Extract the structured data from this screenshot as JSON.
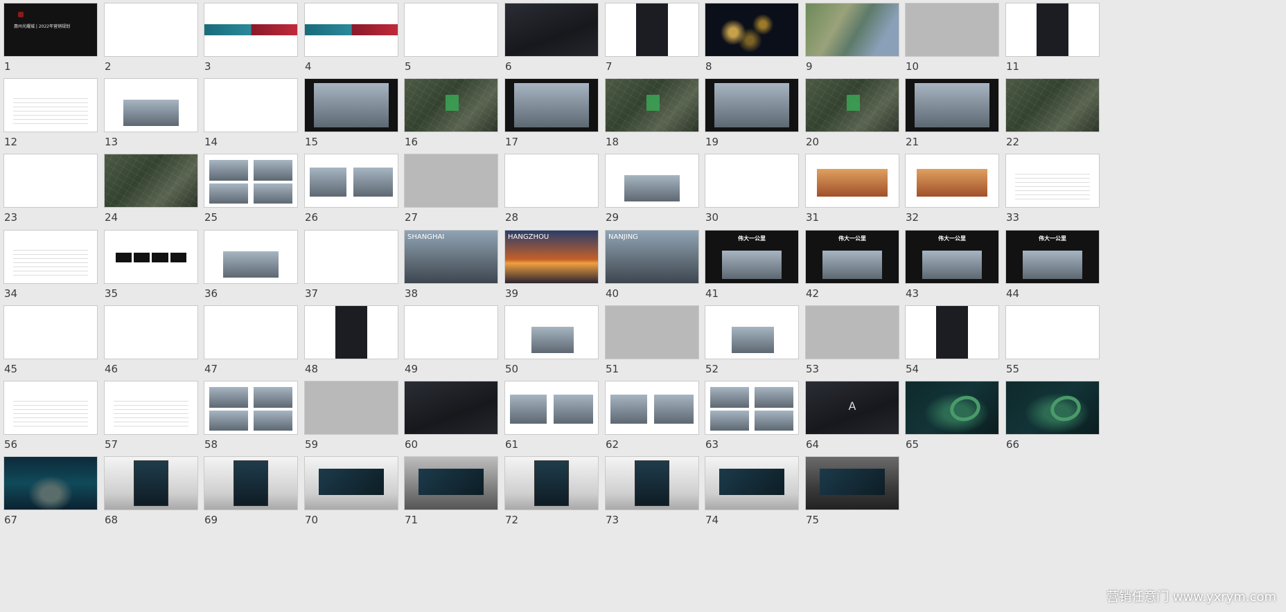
{
  "cover_title": "惠州光耀城 | 2022年营销规划",
  "slides": [
    {
      "n": "1",
      "style": "black",
      "kind": "cover"
    },
    {
      "n": "2",
      "style": "white"
    },
    {
      "n": "3",
      "style": "white",
      "kind": "banner"
    },
    {
      "n": "4",
      "style": "white",
      "kind": "banner"
    },
    {
      "n": "5",
      "style": "white"
    },
    {
      "n": "6",
      "style": "dark"
    },
    {
      "n": "7",
      "style": "white",
      "kind": "panel"
    },
    {
      "n": "8",
      "style": "night"
    },
    {
      "n": "9",
      "style": "sat"
    },
    {
      "n": "10",
      "style": "gray"
    },
    {
      "n": "11",
      "style": "white",
      "kind": "panel"
    },
    {
      "n": "12",
      "style": "white",
      "kind": "doc"
    },
    {
      "n": "13",
      "style": "white",
      "kind": "mapinset"
    },
    {
      "n": "14",
      "style": "white"
    },
    {
      "n": "15",
      "style": "black",
      "kind": "photo"
    },
    {
      "n": "16",
      "style": "map",
      "kind": "plot"
    },
    {
      "n": "17",
      "style": "black",
      "kind": "photo"
    },
    {
      "n": "18",
      "style": "map",
      "kind": "plot"
    },
    {
      "n": "19",
      "style": "black",
      "kind": "photo"
    },
    {
      "n": "20",
      "style": "map",
      "kind": "plot"
    },
    {
      "n": "21",
      "style": "black",
      "kind": "photo"
    },
    {
      "n": "22",
      "style": "map"
    },
    {
      "n": "23",
      "style": "white"
    },
    {
      "n": "24",
      "style": "map"
    },
    {
      "n": "25",
      "style": "white",
      "kind": "collage"
    },
    {
      "n": "26",
      "style": "white",
      "kind": "collage2"
    },
    {
      "n": "27",
      "style": "gray"
    },
    {
      "n": "28",
      "style": "white"
    },
    {
      "n": "29",
      "style": "white",
      "kind": "mapinset"
    },
    {
      "n": "30",
      "style": "white"
    },
    {
      "n": "31",
      "style": "white",
      "kind": "warm"
    },
    {
      "n": "32",
      "style": "white",
      "kind": "warm"
    },
    {
      "n": "33",
      "style": "white",
      "kind": "doc"
    },
    {
      "n": "34",
      "style": "white",
      "kind": "doc"
    },
    {
      "n": "35",
      "style": "white",
      "kind": "boxes"
    },
    {
      "n": "36",
      "style": "white",
      "kind": "mapinset"
    },
    {
      "n": "37",
      "style": "white"
    },
    {
      "n": "38",
      "style": "photo",
      "kind": "city",
      "city": "SHANGHAI"
    },
    {
      "n": "39",
      "style": "sunset",
      "kind": "city",
      "city": "HANGZHOU"
    },
    {
      "n": "40",
      "style": "photo",
      "kind": "city",
      "city": "NANJING"
    },
    {
      "n": "41",
      "style": "black",
      "kind": "headline",
      "headline": "伟大一公里"
    },
    {
      "n": "42",
      "style": "black",
      "kind": "headline",
      "headline": "伟大一公里"
    },
    {
      "n": "43",
      "style": "black",
      "kind": "headline",
      "headline": "伟大一公里"
    },
    {
      "n": "44",
      "style": "black",
      "kind": "headline",
      "headline": "伟大一公里"
    },
    {
      "n": "45",
      "style": "white"
    },
    {
      "n": "46",
      "style": "white"
    },
    {
      "n": "47",
      "style": "white"
    },
    {
      "n": "48",
      "style": "white",
      "kind": "panel"
    },
    {
      "n": "49",
      "style": "white"
    },
    {
      "n": "50",
      "style": "white",
      "kind": "photo-small"
    },
    {
      "n": "51",
      "style": "gray"
    },
    {
      "n": "52",
      "style": "white",
      "kind": "photo-small"
    },
    {
      "n": "53",
      "style": "gray"
    },
    {
      "n": "54",
      "style": "white",
      "kind": "panel"
    },
    {
      "n": "55",
      "style": "white"
    },
    {
      "n": "56",
      "style": "white",
      "kind": "doc"
    },
    {
      "n": "57",
      "style": "white",
      "kind": "doc"
    },
    {
      "n": "58",
      "style": "white",
      "kind": "collage"
    },
    {
      "n": "59",
      "style": "gray"
    },
    {
      "n": "60",
      "style": "dark"
    },
    {
      "n": "61",
      "style": "white",
      "kind": "collage2"
    },
    {
      "n": "62",
      "style": "white",
      "kind": "collage2"
    },
    {
      "n": "63",
      "style": "white",
      "kind": "collage"
    },
    {
      "n": "64",
      "style": "dark",
      "kind": "letter",
      "letter": "A"
    },
    {
      "n": "65",
      "style": "teal",
      "kind": "ring"
    },
    {
      "n": "66",
      "style": "teal",
      "kind": "ring"
    },
    {
      "n": "67",
      "style": "ocean"
    },
    {
      "n": "68",
      "style": "studio",
      "kind": "sign"
    },
    {
      "n": "69",
      "style": "studio",
      "kind": "sign"
    },
    {
      "n": "70",
      "style": "studio",
      "kind": "board"
    },
    {
      "n": "71",
      "style": "street",
      "kind": "board"
    },
    {
      "n": "72",
      "style": "studio",
      "kind": "sign"
    },
    {
      "n": "73",
      "style": "studio",
      "kind": "sign"
    },
    {
      "n": "74",
      "style": "studio",
      "kind": "board"
    },
    {
      "n": "75",
      "style": "room",
      "kind": "board"
    }
  ],
  "watermark": "营销任意门 www.yxrym.com"
}
